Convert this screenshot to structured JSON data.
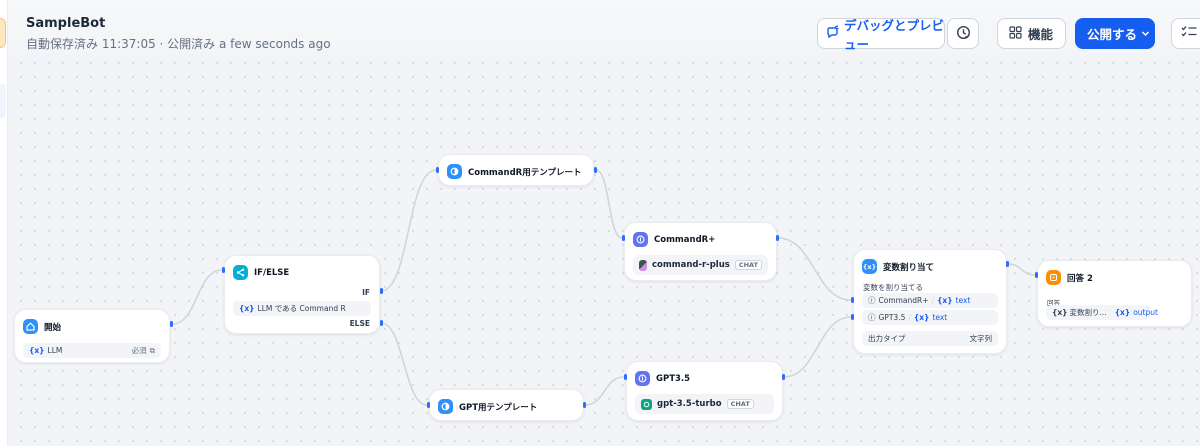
{
  "app": {
    "name": "SampleBot",
    "status": "自動保存済み 11:37:05 · 公開済み a few seconds ago"
  },
  "toolbar": {
    "debug_label": "デバッグとプレビュー",
    "features_label": "機能",
    "publish_label": "公開する"
  },
  "icons": {
    "debug": "debug-bug-icon",
    "history": "history-clock-icon",
    "features": "grid-icon",
    "publish": "chevron-down-icon",
    "checklist": "checklist-icon"
  },
  "colors": {
    "accent": "#155eef",
    "edge": "#d0d5dd",
    "handle": "#2970ff"
  },
  "nodes": {
    "start": {
      "title": "開始",
      "var_symbol": "{x}",
      "var_name": "LLM",
      "required": "必須"
    },
    "ifelse": {
      "title": "IF/ELSE",
      "if_label": "IF",
      "condition_symbol": "{x}",
      "condition": "LLM である Command R",
      "else_label": "ELSE"
    },
    "tpl_commandr": {
      "title": "CommandR用テンプレート"
    },
    "tpl_gpt": {
      "title": "GPT用テンプレート"
    },
    "llm_commandr": {
      "title": "CommandR+",
      "model": "command-r-plus",
      "badge": "CHAT"
    },
    "llm_gpt": {
      "title": "GPT3.5",
      "model": "gpt-3.5-turbo",
      "badge": "CHAT"
    },
    "assigner": {
      "title": "変数割り当て",
      "subtitle": "変数を割り当てる",
      "vars": [
        {
          "source": "CommandR+",
          "symbol": "{x}",
          "name": "text"
        },
        {
          "source": "GPT3.5",
          "symbol": "{x}",
          "name": "text"
        }
      ],
      "output_type_label": "出力タイプ",
      "output_type_value": "文字列"
    },
    "answer": {
      "title": "回答 2",
      "field_label": "回答",
      "source_symbol": "{x}",
      "source": "変数割り...",
      "var_symbol": "{x}",
      "var_name": "output"
    }
  }
}
